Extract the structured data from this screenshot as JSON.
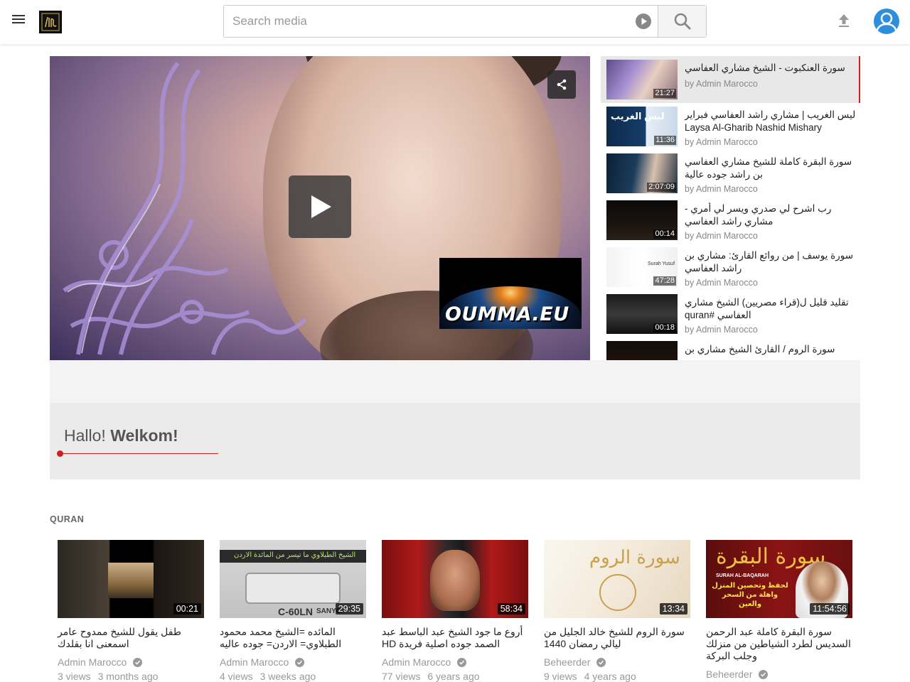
{
  "header": {
    "search_placeholder": "Search media"
  },
  "player": {
    "watermark_text": "OUMMA.EU"
  },
  "playlist": [
    {
      "title": "سورة العنكبوت - الشيخ مشاري العفاسي",
      "by": "by Admin Marocco",
      "duration": "21:27",
      "active": true
    },
    {
      "title": "ليس الغريب | مشاري راشد العفاسي فبراير Laysa Al-Gharib Nashid Mishary",
      "by": "by Admin Marocco",
      "duration": "11:36",
      "thumb_text": "ليس الغريب"
    },
    {
      "title": "سورة البقرة كاملة للشيخ مشاري العفاسي بن راشد جوده عالية",
      "by": "by Admin Marocco",
      "duration": "2:07:09"
    },
    {
      "title": "رب اشرح لي صدري ويسر لي أمري - مشاري راشد العفاسي",
      "by": "by Admin Marocco",
      "duration": "00:14"
    },
    {
      "title": "سورة يوسف | من روائع القارئ: مشاري بن راشد العفاسي",
      "by": "by Admin Marocco",
      "duration": "47:28",
      "thumb_text": "Surah Yusuf"
    },
    {
      "title": "تقليد قليل ل(قراء مصريين) الشيخ مشاري العفاسي #quran",
      "by": "by Admin Marocco",
      "duration": "00:18"
    },
    {
      "title": "سورة الروم / القارئ الشيخ مشاري بن",
      "by": "",
      "duration": ""
    }
  ],
  "welcome": {
    "prefix": "Hallo! ",
    "bold": "Welkom!"
  },
  "section": {
    "title": "QURAN",
    "cards": [
      {
        "title": "طفل يقول للشيخ ممدوح عامر اسمعنى انا بقلدك",
        "author": "Admin Marocco",
        "views": "3 views",
        "age": "3 months ago",
        "duration": "00:21"
      },
      {
        "title": "المائده =الشيخ محمد محمود الطبلاوي= الاردن= جوده عاليه",
        "author": "Admin Marocco",
        "views": "4 views",
        "age": "3 weeks ago",
        "duration": "29:35",
        "thumb_text": "C-60LN",
        "thumb_brand": "SANYO",
        "thumb_caption": "الشيخ الطبلاوي ما تيسر من المائدة الاردن"
      },
      {
        "title": "أروع ما جود الشيخ عبد الباسط عبد الصمد جوده اصلية فريدة HD",
        "author": "Admin Marocco",
        "views": "77 views",
        "age": "6 years ago",
        "duration": "58:34"
      },
      {
        "title": "سورة الروم للشيخ خالد الجليل من ليالي رمضان 1440",
        "author": "Beheerder",
        "views": "9 views",
        "age": "4 years ago",
        "duration": "13:34",
        "thumb_text": "سورة الروم"
      },
      {
        "title": "سورة البقرة كاملة عبد الرحمن السديس لطرد الشياطين من منزلك وجلب البركة",
        "author": "Beheerder",
        "views": "",
        "age": "",
        "duration": "11:54:56",
        "thumb_text": "سورة البقرة",
        "thumb_sub": "SURAH AL-BAQARAH",
        "thumb_yellow": "لحفظ وتحصين المنزل واهلة من السحر والعين"
      }
    ]
  },
  "colors": {
    "accent_red": "#cc1f1f",
    "avatar_blue": "#2e8ede"
  }
}
